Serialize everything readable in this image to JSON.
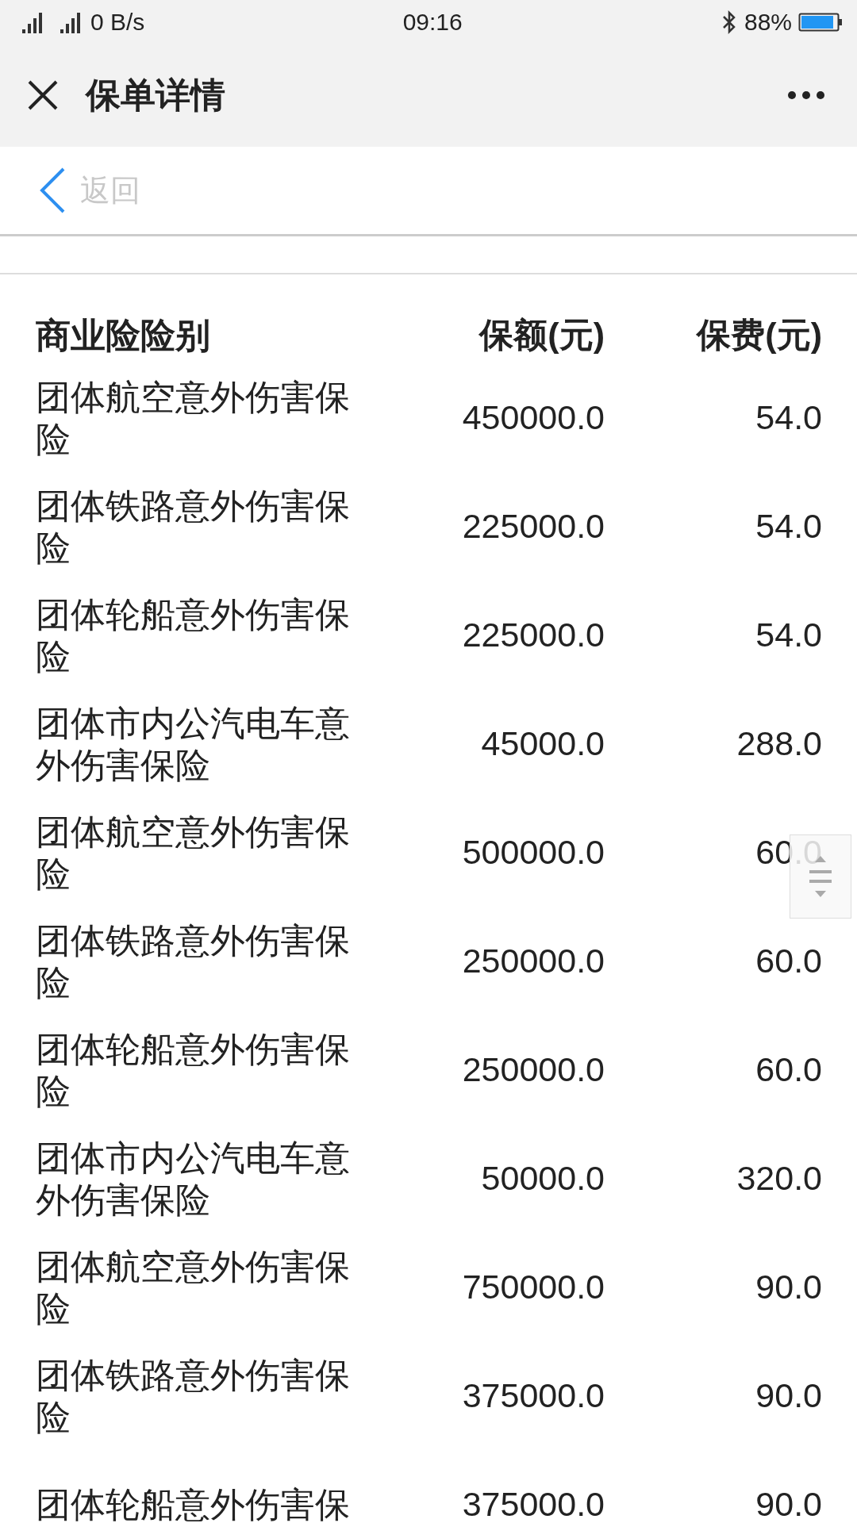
{
  "status_bar": {
    "network_speed": "0 B/s",
    "time": "09:16",
    "battery": "88%"
  },
  "header": {
    "title": "保单详情"
  },
  "back_bar": {
    "label": "返回"
  },
  "table": {
    "columns": [
      "商业险险别",
      "保额(元)",
      "保费(元)"
    ],
    "rows": [
      {
        "name": "团体航空意外伤害保险",
        "amount": "450000.0",
        "premium": "54.0"
      },
      {
        "name": "团体铁路意外伤害保险",
        "amount": "225000.0",
        "premium": "54.0"
      },
      {
        "name": "团体轮船意外伤害保险",
        "amount": "225000.0",
        "premium": "54.0"
      },
      {
        "name": "团体市内公汽电车意外伤害保险",
        "amount": "45000.0",
        "premium": "288.0"
      },
      {
        "name": "团体航空意外伤害保险",
        "amount": "500000.0",
        "premium": "60.0"
      },
      {
        "name": "团体铁路意外伤害保险",
        "amount": "250000.0",
        "premium": "60.0"
      },
      {
        "name": "团体轮船意外伤害保险",
        "amount": "250000.0",
        "premium": "60.0"
      },
      {
        "name": "团体市内公汽电车意外伤害保险",
        "amount": "50000.0",
        "premium": "320.0"
      },
      {
        "name": "团体航空意外伤害保险",
        "amount": "750000.0",
        "premium": "90.0"
      },
      {
        "name": "团体铁路意外伤害保险",
        "amount": "375000.0",
        "premium": "90.0"
      },
      {
        "name": "团体轮船意外伤害保",
        "amount": "375000.0",
        "premium": "90.0"
      }
    ]
  }
}
